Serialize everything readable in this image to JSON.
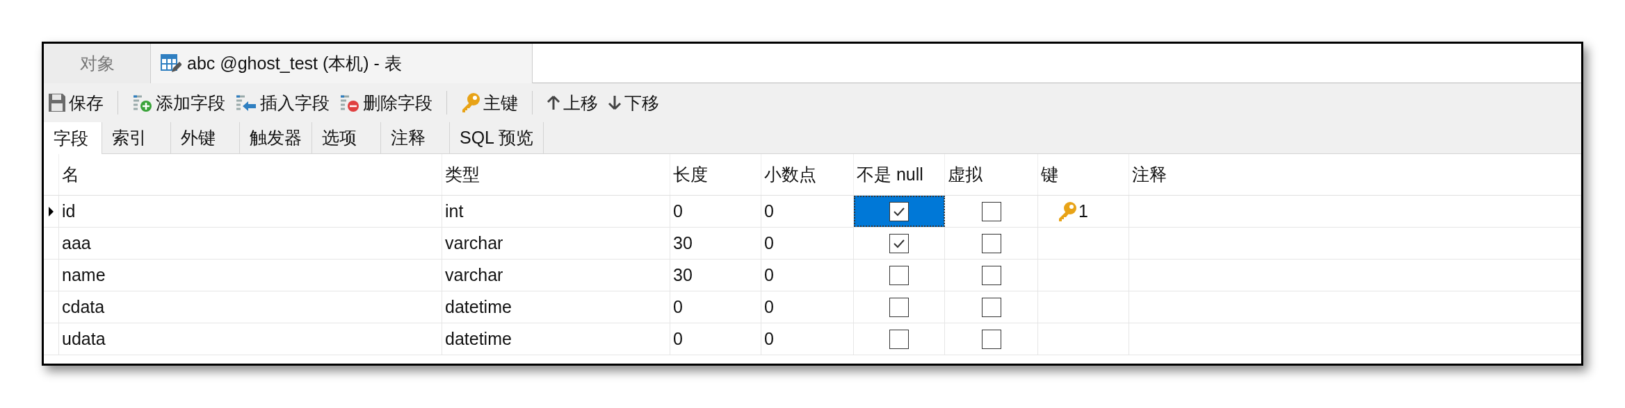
{
  "window_tabs": [
    {
      "label": "对象",
      "selected": false,
      "kind": "plain"
    },
    {
      "label": "abc @ghost_test (本机) - 表",
      "selected": true,
      "kind": "table-design"
    }
  ],
  "toolbar": {
    "groups": [
      [
        {
          "kind": "save",
          "label": "保存"
        }
      ],
      [
        {
          "kind": "add",
          "label": "添加字段"
        },
        {
          "kind": "insert",
          "label": "插入字段"
        },
        {
          "kind": "delete",
          "label": "删除字段"
        }
      ],
      [
        {
          "kind": "key",
          "label": "主键"
        }
      ],
      [
        {
          "kind": "up",
          "label": "上移"
        },
        {
          "kind": "down",
          "label": "下移"
        }
      ]
    ]
  },
  "sub_tabs": [
    {
      "label": "字段",
      "selected": true
    },
    {
      "label": "索引",
      "selected": false
    },
    {
      "label": "外键",
      "selected": false
    },
    {
      "label": "触发器",
      "selected": false
    },
    {
      "label": "选项",
      "selected": false
    },
    {
      "label": "注释",
      "selected": false
    },
    {
      "label": "SQL 预览",
      "selected": false
    }
  ],
  "table": {
    "columns": [
      "名",
      "类型",
      "长度",
      "小数点",
      "不是 null",
      "虚拟",
      "键",
      "注释"
    ],
    "rows": [
      {
        "current": true,
        "name": "id",
        "type": "int",
        "length": "0",
        "decimals": "0",
        "not_null": {
          "checked": true,
          "selected": true
        },
        "virtual": {
          "checked": false
        },
        "key": "1"
      },
      {
        "current": false,
        "name": "aaa",
        "type": "varchar",
        "length": "30",
        "decimals": "0",
        "not_null": {
          "checked": true,
          "selected": false
        },
        "virtual": {
          "checked": false
        }
      },
      {
        "current": false,
        "name": "name",
        "type": "varchar",
        "length": "30",
        "decimals": "0",
        "not_null": {
          "checked": false,
          "selected": false
        },
        "virtual": {
          "checked": false
        }
      },
      {
        "current": false,
        "name": "cdata",
        "type": "datetime",
        "length": "0",
        "decimals": "0",
        "not_null": {
          "checked": false,
          "selected": false
        },
        "virtual": {
          "checked": false
        }
      },
      {
        "current": false,
        "name": "udata",
        "type": "datetime",
        "length": "0",
        "decimals": "0",
        "not_null": {
          "checked": false,
          "selected": false
        },
        "virtual": {
          "checked": false
        }
      }
    ]
  }
}
